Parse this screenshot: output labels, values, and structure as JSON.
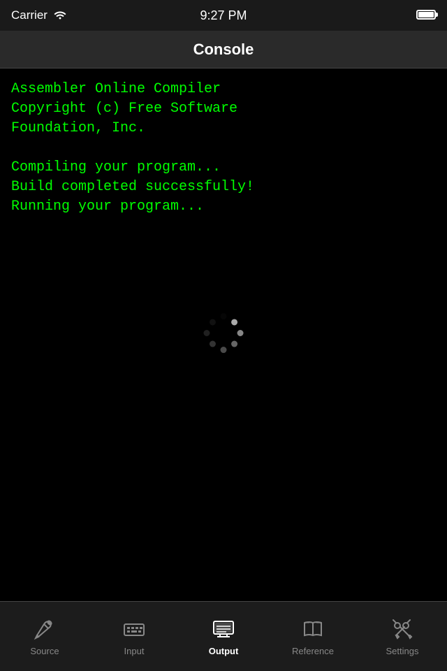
{
  "statusBar": {
    "carrier": "Carrier",
    "time": "9:27 PM"
  },
  "navBar": {
    "title": "Console"
  },
  "console": {
    "text": "Assembler Online Compiler\nCopyright (c) Free Software\nFoundation, Inc.\n\nCompiling your program...\nBuild completed successfully!\nRunning your program..."
  },
  "tabBar": {
    "items": [
      {
        "id": "source",
        "label": "Source",
        "active": false
      },
      {
        "id": "input",
        "label": "Input",
        "active": false
      },
      {
        "id": "output",
        "label": "Output",
        "active": true
      },
      {
        "id": "reference",
        "label": "Reference",
        "active": false
      },
      {
        "id": "settings",
        "label": "Settings",
        "active": false
      }
    ]
  }
}
